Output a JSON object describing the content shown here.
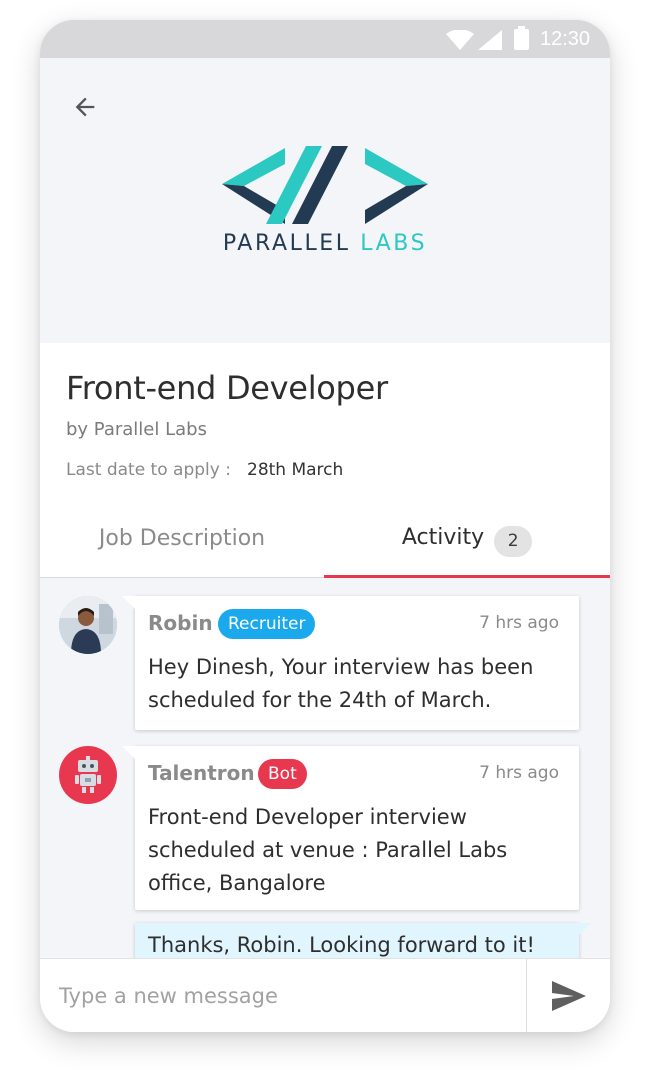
{
  "status_bar": {
    "time": "12:30",
    "icons": [
      "wifi-icon",
      "signal-icon",
      "battery-icon"
    ]
  },
  "header": {
    "back_icon": "arrow-left-icon",
    "company_logo": {
      "word1": "PARALLEL",
      "word2": "LABS",
      "colors": {
        "dark": "#233b52",
        "teal": "#2cc8c2"
      }
    }
  },
  "job": {
    "title": "Front-end Developer",
    "company_line": "by Parallel Labs",
    "deadline_label": "Last date to apply :",
    "deadline_value": "28th March"
  },
  "tabs": [
    {
      "label": "Job Description",
      "active": false
    },
    {
      "label": "Activity",
      "count": "2",
      "active": true
    }
  ],
  "messages": [
    {
      "sender": "Robin",
      "role": "Recruiter",
      "time": "7 hrs ago",
      "text": "Hey Dinesh, Your interview has been scheduled for the 24th of March."
    },
    {
      "sender": "Talentron",
      "role": "Bot",
      "time": "7 hrs ago",
      "text": "Front-end Developer interview scheduled at venue : Parallel Labs office, Bangalore"
    }
  ],
  "reply": {
    "text": "Thanks, Robin. Looking forward to it!"
  },
  "composer": {
    "placeholder": "Type a new message",
    "send_icon": "send-icon"
  },
  "colors": {
    "accent": "#e8384f",
    "recruiter_badge": "#1ba9ee",
    "bot_badge": "#e8384f",
    "reply_bubble": "#e0f5fd"
  }
}
